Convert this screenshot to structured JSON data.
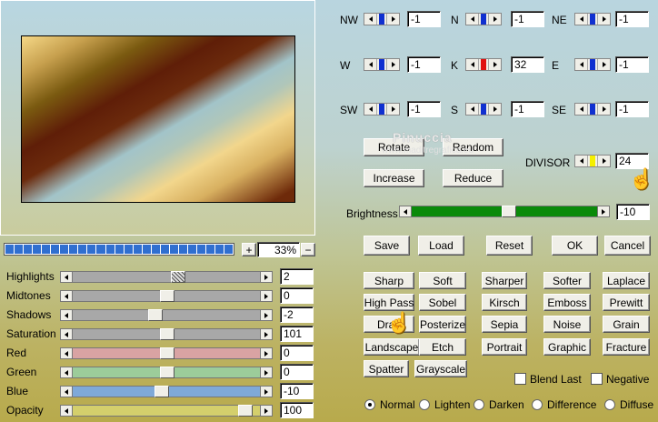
{
  "zoom": {
    "value": "33%",
    "plus": "+",
    "minus": "−"
  },
  "sliders": [
    {
      "label": "Highlights",
      "value": "2",
      "pos": 0.56,
      "color": "#a8a8a8",
      "hatched": true
    },
    {
      "label": "Midtones",
      "value": "0",
      "pos": 0.5,
      "color": "#a8a8a8"
    },
    {
      "label": "Shadows",
      "value": "-2",
      "pos": 0.43,
      "color": "#a8a8a8"
    },
    {
      "label": "Saturation",
      "value": "101",
      "pos": 0.5,
      "color": "#a8a8a8"
    },
    {
      "label": "Red",
      "value": "0",
      "pos": 0.5,
      "color": "#d9a3a3"
    },
    {
      "label": "Green",
      "value": "0",
      "pos": 0.5,
      "color": "#9ccc9a"
    },
    {
      "label": "Blue",
      "value": "-10",
      "pos": 0.47,
      "color": "#7fa9d8"
    },
    {
      "label": "Opacity",
      "value": "100",
      "pos": 0.95,
      "color": "#d4cf6c"
    }
  ],
  "kernel": [
    {
      "label": "NW",
      "value": "-1",
      "color": "#1030d0"
    },
    {
      "label": "N",
      "value": "-1",
      "color": "#1030d0"
    },
    {
      "label": "NE",
      "value": "-1",
      "color": "#1030d0"
    },
    {
      "label": "W",
      "value": "-1",
      "color": "#1030d0"
    },
    {
      "label": "K",
      "value": "32",
      "color": "#e01010"
    },
    {
      "label": "E",
      "value": "-1",
      "color": "#1030d0"
    },
    {
      "label": "SW",
      "value": "-1",
      "color": "#1030d0"
    },
    {
      "label": "S",
      "value": "-1",
      "color": "#1030d0"
    },
    {
      "label": "SE",
      "value": "-1",
      "color": "#1030d0"
    }
  ],
  "buttons": {
    "rotate": "Rotate",
    "random": "Random",
    "increase": "Increase",
    "reduce": "Reduce",
    "save": "Save",
    "load": "Load",
    "reset": "Reset",
    "ok": "OK",
    "cancel": "Cancel"
  },
  "divisor": {
    "label": "DIVISOR",
    "value": "24",
    "color": "#f5f000"
  },
  "brightness": {
    "label": "Brightness",
    "value": "-10",
    "pos": 0.52,
    "color": "#0a8a0a"
  },
  "presets": [
    "Sharp",
    "Soft",
    "Sharper",
    "Softer",
    "Laplace",
    "High Pass",
    "Sobel",
    "Kirsch",
    "Emboss",
    "Prewitt",
    "Drag",
    "Posterize",
    "Sepia",
    "Noise",
    "Grain",
    "Landscape",
    "Etch",
    "Portrait",
    "Graphic",
    "Fracture",
    "Spatter",
    "Grayscale"
  ],
  "checks": {
    "blend_last": "Blend Last",
    "negative": "Negative"
  },
  "modes": [
    {
      "label": "Normal",
      "on": true
    },
    {
      "label": "Lighten"
    },
    {
      "label": "Darken"
    },
    {
      "label": "Difference"
    },
    {
      "label": "Diffuse"
    }
  ],
  "watermark": {
    "line1": "Pinuccia",
    "line2": "www.maditregrafica.eu"
  }
}
